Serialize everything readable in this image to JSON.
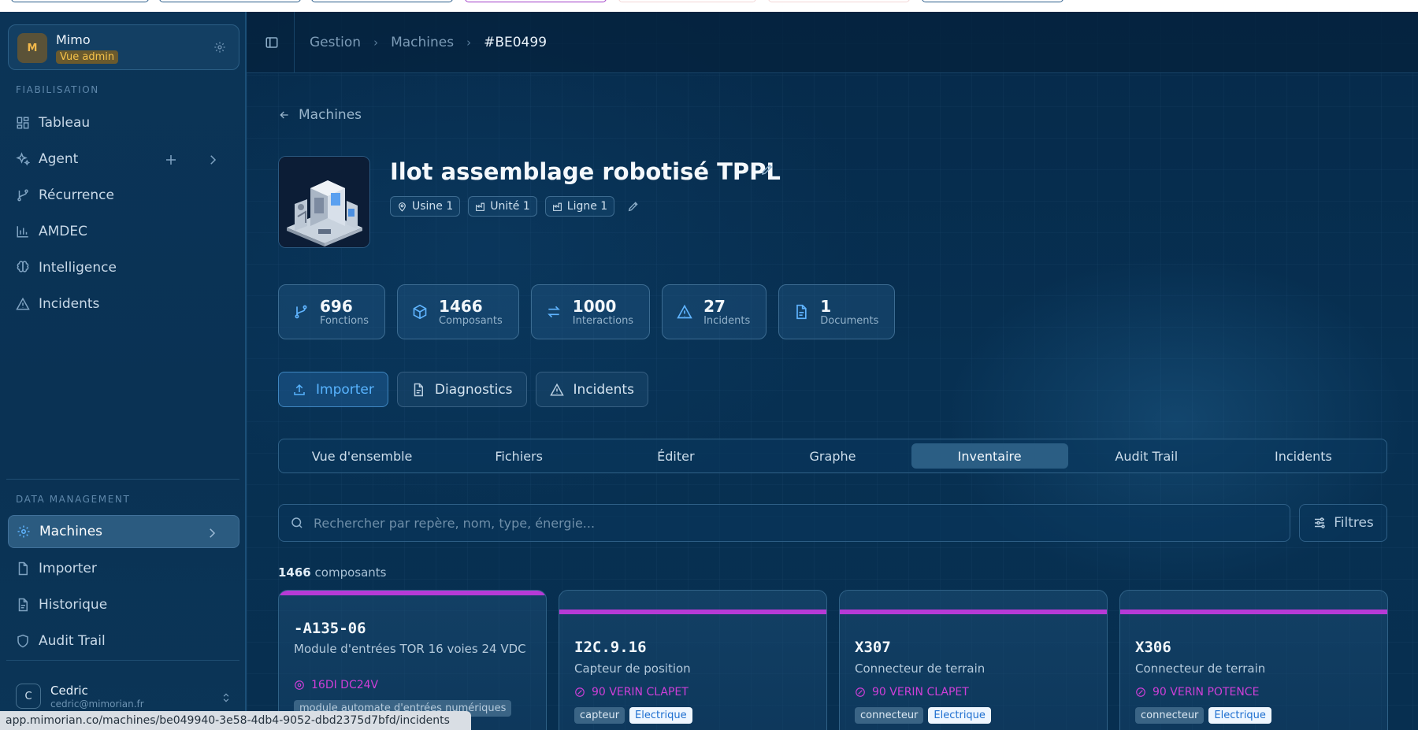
{
  "sidebar": {
    "profile": {
      "initial": "M",
      "name": "Mimo",
      "badge": "Vue admin"
    },
    "section_fiabilisation": "FIABILISATION",
    "nav_top": [
      {
        "label": "Tableau",
        "icon": "grid-icon"
      },
      {
        "label": "Agent",
        "icon": "sparkles-icon"
      },
      {
        "label": "Récurrence",
        "icon": "branch-icon"
      },
      {
        "label": "AMDEC",
        "icon": "bar-chart-icon"
      },
      {
        "label": "Intelligence",
        "icon": "brain-icon"
      },
      {
        "label": "Incidents",
        "icon": "warning-icon"
      }
    ],
    "section_data": "DATA MANAGEMENT",
    "nav_data": [
      {
        "label": "Machines",
        "icon": "gear-icon",
        "active": true
      },
      {
        "label": "Importer",
        "icon": "document-icon"
      },
      {
        "label": "Historique",
        "icon": "document-icon"
      },
      {
        "label": "Audit Trail",
        "icon": "shield-icon"
      }
    ],
    "user": {
      "initial": "C",
      "name": "Cedric",
      "email": "cedric@mimorian.fr"
    }
  },
  "status_url": "app.mimorian.co/machines/be049940-3e58-4db4-9052-dbd2375d7bfd/incidents",
  "breadcrumb": {
    "items": [
      "Gestion",
      "Machines"
    ],
    "current": "#BE0499"
  },
  "back_label": "Machines",
  "machine": {
    "title": "Ilot assemblage robotisé TPPL",
    "location": [
      "Usine 1",
      "Unité 1",
      "Ligne 1"
    ]
  },
  "stats": [
    {
      "value": "696",
      "label": "Fonctions",
      "icon": "branch-icon"
    },
    {
      "value": "1466",
      "label": "Composants",
      "icon": "cube-icon"
    },
    {
      "value": "1000",
      "label": "Interactions",
      "icon": "arrows-icon"
    },
    {
      "value": "27",
      "label": "Incidents",
      "icon": "warning-icon"
    },
    {
      "value": "1",
      "label": "Documents",
      "icon": "document-icon"
    }
  ],
  "actions": [
    {
      "label": "Importer",
      "icon": "upload-icon"
    },
    {
      "label": "Diagnostics",
      "icon": "document-icon"
    },
    {
      "label": "Incidents",
      "icon": "warning-icon"
    }
  ],
  "tabs": [
    "Vue d'ensemble",
    "Fichiers",
    "Éditer",
    "Graphe",
    "Inventaire",
    "Audit Trail",
    "Incidents"
  ],
  "active_tab": "Inventaire",
  "search": {
    "placeholder": "Rechercher par repère, nom, type, énergie...",
    "value": ""
  },
  "filters_label": "Filtres",
  "count": {
    "number": "1466",
    "label": "composants"
  },
  "accent_color": "#b63ad6",
  "components": [
    {
      "ref": "-A135-06",
      "desc": "Module d'entrées TOR 16 voies 24 VDC",
      "func": "16DI DC24V",
      "chips": [
        "module automate d'entrées numériques"
      ]
    },
    {
      "ref": "I2C.9.16",
      "desc": "Capteur de position",
      "func": "90 VERIN CLAPET",
      "chips": [
        "capteur",
        "Electrique"
      ]
    },
    {
      "ref": "X307",
      "desc": "Connecteur de terrain",
      "func": "90 VERIN CLAPET",
      "chips": [
        "connecteur",
        "Electrique"
      ]
    },
    {
      "ref": "X306",
      "desc": "Connecteur de terrain",
      "func": "90 VERIN POTENCE",
      "chips": [
        "connecteur",
        "Electrique"
      ]
    }
  ]
}
